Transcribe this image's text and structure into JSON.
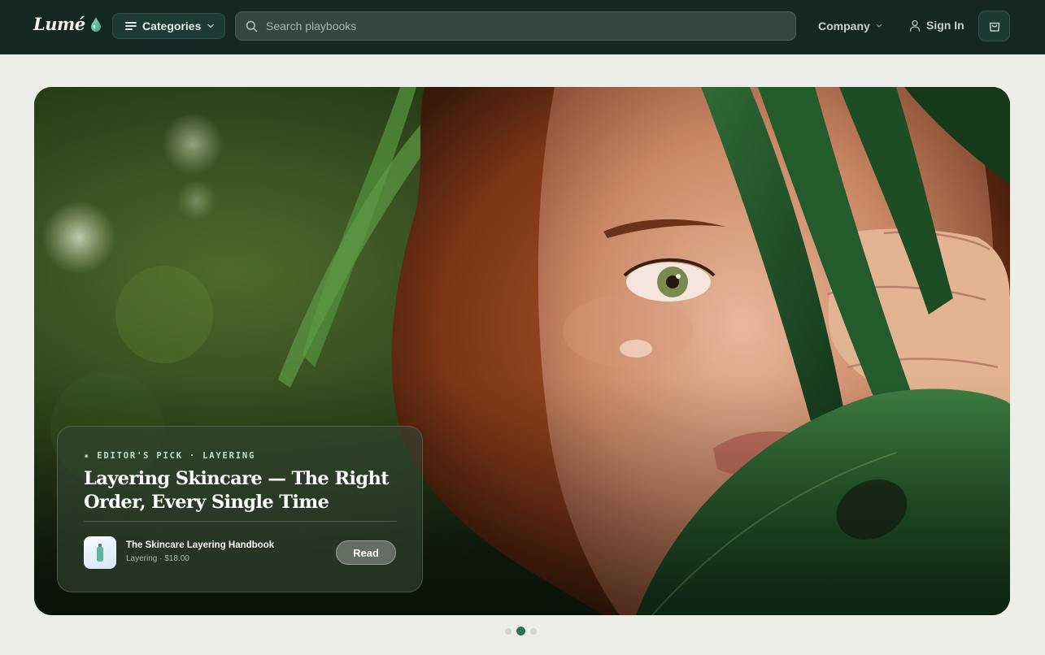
{
  "brand": {
    "name": "Lumé",
    "icon": "droplet-icon",
    "accent": "#5fb49a"
  },
  "nav": {
    "categories_label": "Categories",
    "search_placeholder": "Search playbooks",
    "company_label": "Company",
    "signin_label": "Sign In",
    "cart_icon": "shopping-bag-icon"
  },
  "colors": {
    "topbar": "#142723",
    "page_bg": "#eeeee9",
    "active_dot": "#2d7155"
  },
  "hero": {
    "eyebrow": "✷ EDITOR'S PICK · LAYERING",
    "title": "Layering Skincare — The Right Order, Every Single Time",
    "product": {
      "name": "The Skincare Layering Handbook",
      "meta": "Layering · $18.00",
      "icon": "bottle-icon"
    },
    "cta_label": "Read"
  },
  "carousel": {
    "count": 3,
    "active_index": 1
  }
}
